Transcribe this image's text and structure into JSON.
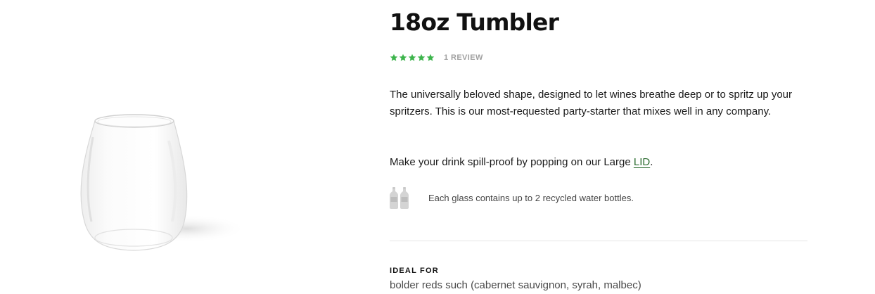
{
  "product": {
    "title": "18oz Tumbler",
    "rating": {
      "stars": 5,
      "max_stars": 5,
      "reviews_label": "1 REVIEW",
      "star_color": "#3cb44b"
    },
    "description": "The universally beloved shape, designed to let wines breathe deep or to spritz up your spritzers. This is our most-requested party-starter that mixes well in any company.",
    "lid_prompt": {
      "text_before": "Make your drink spill-proof by popping on our Large ",
      "link_text": "LID",
      "text_after": "."
    },
    "recycle": {
      "icon": "bottles-icon",
      "text": "Each glass contains up to 2 recycled water bottles."
    },
    "ideal_for": {
      "heading": "IDEAL FOR",
      "text": "bolder reds such (cabernet sauvignon, syrah, malbec)"
    }
  }
}
